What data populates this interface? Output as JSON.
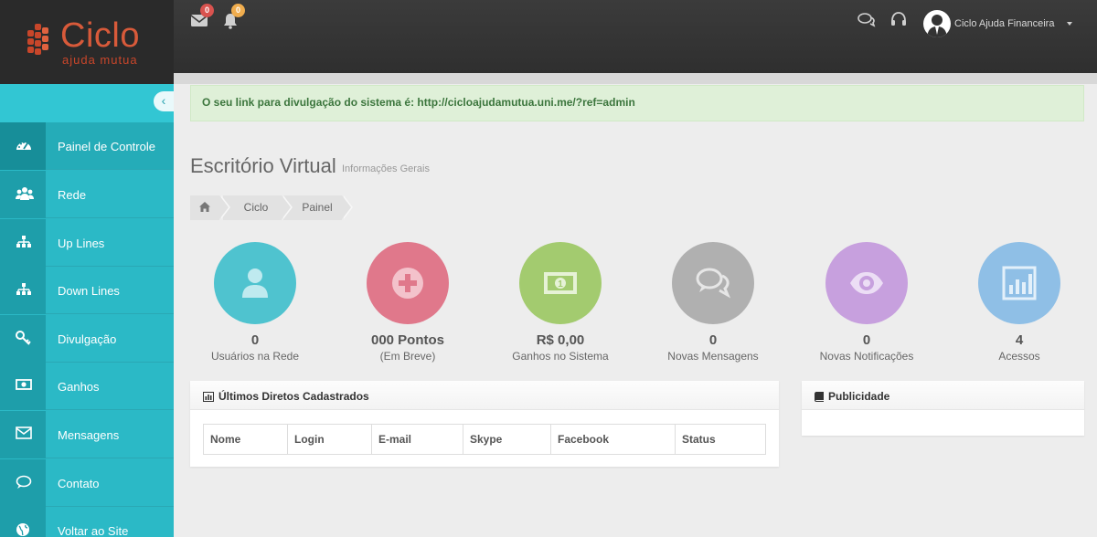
{
  "brand": {
    "title": "Ciclo",
    "subtitle": "ajuda mutua",
    "accent": "#d85a3a"
  },
  "topbar": {
    "messages": {
      "icon": "envelope-icon",
      "count": "0",
      "badge_color": "#d9534f"
    },
    "notifications": {
      "icon": "bell-icon",
      "count": "0",
      "badge_color": "#f0ad4e"
    },
    "chat_icon": "chat-icon",
    "support_icon": "headset-icon",
    "user_name": "Ciclo Ajuda Financeira"
  },
  "sidebar": {
    "color": "#2bb9c6",
    "items": [
      {
        "label": "Painel de Controle",
        "icon": "dashboard-icon",
        "active": true
      },
      {
        "label": "Rede",
        "icon": "users-icon"
      },
      {
        "label": "Up Lines",
        "icon": "sitemap-icon"
      },
      {
        "label": "Down Lines",
        "icon": "sitemap-icon"
      },
      {
        "label": "Divulgação",
        "icon": "key-icon"
      },
      {
        "label": "Ganhos",
        "icon": "money-icon"
      },
      {
        "label": "Mensagens",
        "icon": "envelope-icon"
      },
      {
        "label": "Contato",
        "icon": "comment-icon"
      },
      {
        "label": "Voltar ao Site",
        "icon": "globe-icon"
      }
    ]
  },
  "alert": {
    "text": "O seu link para divulgação do sistema é: http://cicloajudamutua.uni.me/?ref=admin"
  },
  "page": {
    "title": "Escritório Virtual",
    "subtitle": "Informações Gerais"
  },
  "breadcrumb": {
    "home_icon": "home-icon",
    "items": [
      "Ciclo",
      "Painel"
    ]
  },
  "stats": [
    {
      "value": "0",
      "caption": "Usuários na Rede",
      "color": "#4fc3cf",
      "icon": "user-icon"
    },
    {
      "value": "000 Pontos",
      "caption": "(Em Breve)",
      "color": "#e0788b",
      "icon": "plus-icon"
    },
    {
      "value": "R$ 0,00",
      "caption": "Ganhos no Sistema",
      "color": "#a3cb6f",
      "icon": "money-icon"
    },
    {
      "value": "0",
      "caption": "Novas Mensagens",
      "color": "#b0b0b0",
      "icon": "comments-icon"
    },
    {
      "value": "0",
      "caption": "Novas Notificações",
      "color": "#c7a0de",
      "icon": "eye-icon"
    },
    {
      "value": "4",
      "caption": "Acessos",
      "color": "#8fbfe6",
      "icon": "bar-chart-icon"
    }
  ],
  "directs_panel": {
    "title": "Últimos Diretos Cadastrados",
    "columns": [
      "Nome",
      "Login",
      "E-mail",
      "Skype",
      "Facebook",
      "Status"
    ]
  },
  "ads_panel": {
    "title": "Publicidade"
  }
}
